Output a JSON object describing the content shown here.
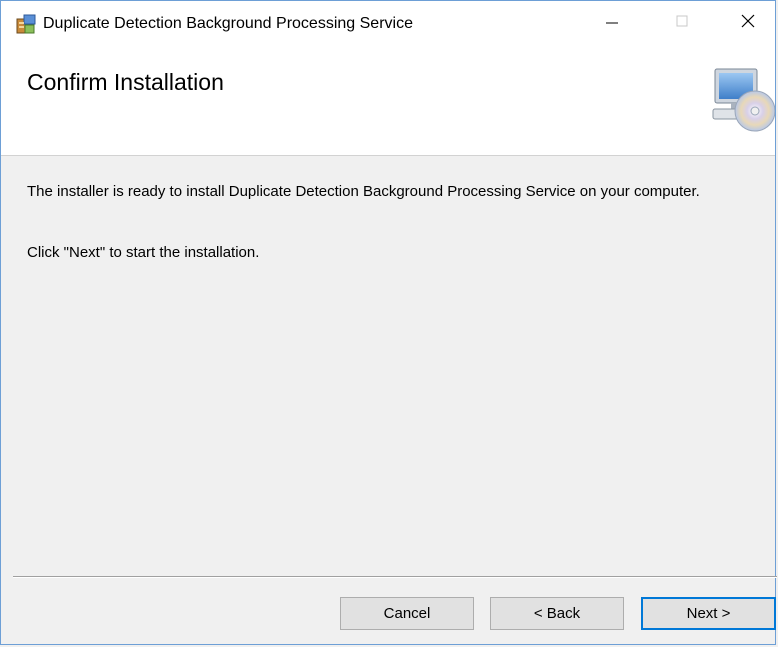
{
  "window": {
    "title": "Duplicate Detection Background Processing Service",
    "controls": {
      "minimize_glyph": "minimize-icon",
      "maximize_glyph": "maximize-icon",
      "close_glyph": "close-icon"
    }
  },
  "header": {
    "title": "Confirm Installation",
    "graphic": "computer-cd-icon"
  },
  "body": {
    "line1": "The installer is ready to install Duplicate Detection Background Processing Service on your computer.",
    "line2": "Click \"Next\" to start the installation."
  },
  "footer": {
    "cancel_label": "Cancel",
    "back_label": "< Back",
    "next_label": "Next >"
  },
  "colors": {
    "window_border": "#6d9fd6",
    "default_button_border": "#0078d7",
    "panel_background": "#f0f0f0"
  }
}
